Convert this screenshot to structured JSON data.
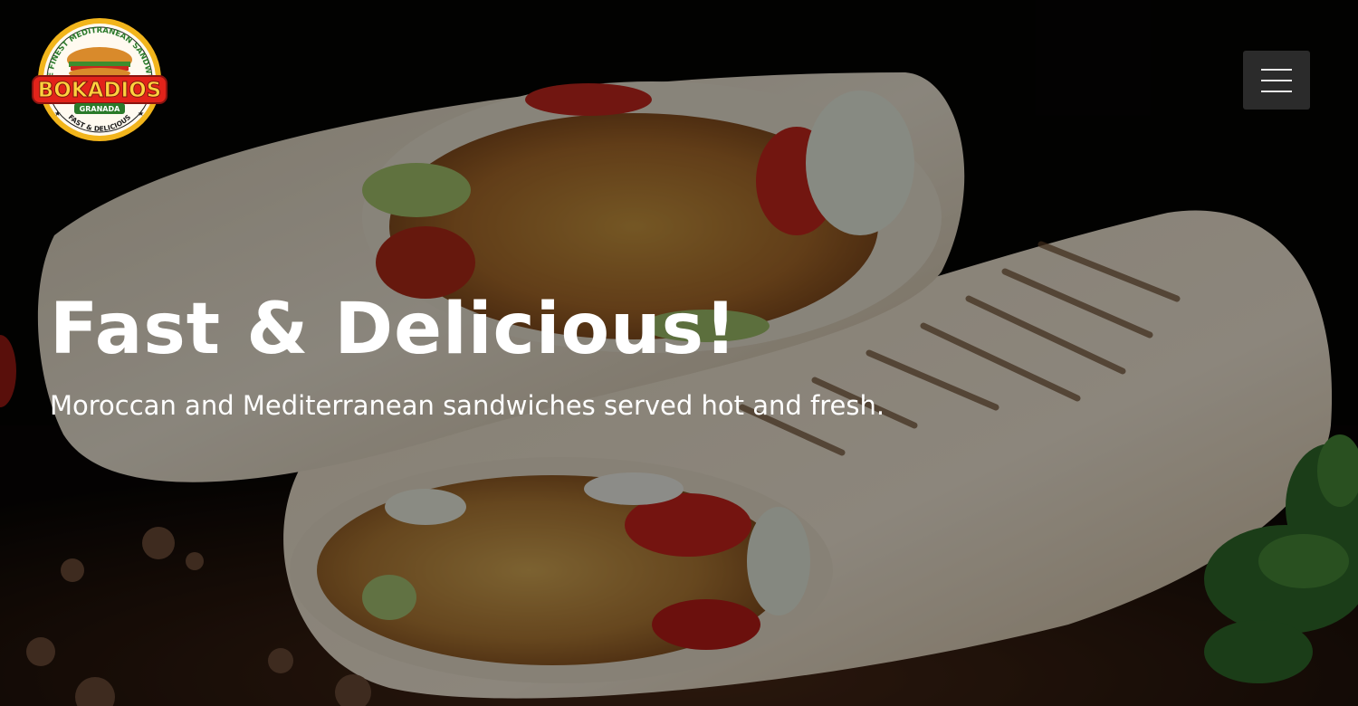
{
  "brand": {
    "logo_top_text": "THE FINEST MEDITRANEAN SANDWICH",
    "logo_name": "BOKADIOS",
    "logo_city": "GRANADA",
    "logo_tagline": "FAST & DELICIOUS"
  },
  "header": {
    "menu_icon": "hamburger-menu-icon"
  },
  "hero": {
    "title": "Fast & Delicious!",
    "subtitle": "Moroccan and Mediterranean sandwiches served hot and fresh.",
    "background_image": "grilled falafel wrap sandwiches on wooden board"
  },
  "colors": {
    "menu_button_bg": "#2b2b2b",
    "hero_text": "#ffffff",
    "logo_ring": "#f2b51c",
    "logo_text": "#e2231a"
  }
}
